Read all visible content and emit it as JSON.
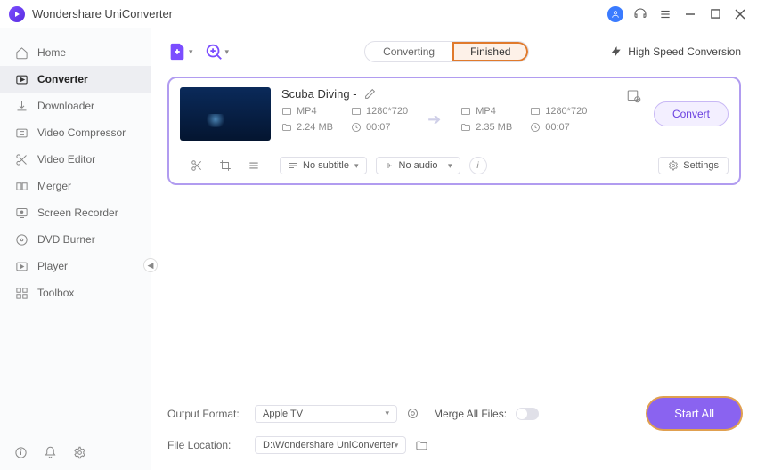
{
  "app": {
    "title": "Wondershare UniConverter"
  },
  "sidebar": {
    "items": [
      {
        "label": "Home"
      },
      {
        "label": "Converter"
      },
      {
        "label": "Downloader"
      },
      {
        "label": "Video Compressor"
      },
      {
        "label": "Video Editor"
      },
      {
        "label": "Merger"
      },
      {
        "label": "Screen Recorder"
      },
      {
        "label": "DVD Burner"
      },
      {
        "label": "Player"
      },
      {
        "label": "Toolbox"
      }
    ]
  },
  "tabs": {
    "converting": "Converting",
    "finished": "Finished"
  },
  "toolbar": {
    "highspeed": "High Speed Conversion"
  },
  "file": {
    "title": "Scuba Diving  -",
    "source": {
      "format": "MP4",
      "resolution": "1280*720",
      "size": "2.24 MB",
      "duration": "00:07"
    },
    "target": {
      "format": "MP4",
      "resolution": "1280*720",
      "size": "2.35 MB",
      "duration": "00:07"
    },
    "subtitle": "No subtitle",
    "audio": "No audio",
    "settings": "Settings",
    "convert": "Convert"
  },
  "bottom": {
    "output_format_label": "Output Format:",
    "output_format_value": "Apple TV",
    "merge_label": "Merge All Files:",
    "file_location_label": "File Location:",
    "file_location_value": "D:\\Wondershare UniConverter",
    "start_all": "Start All"
  }
}
